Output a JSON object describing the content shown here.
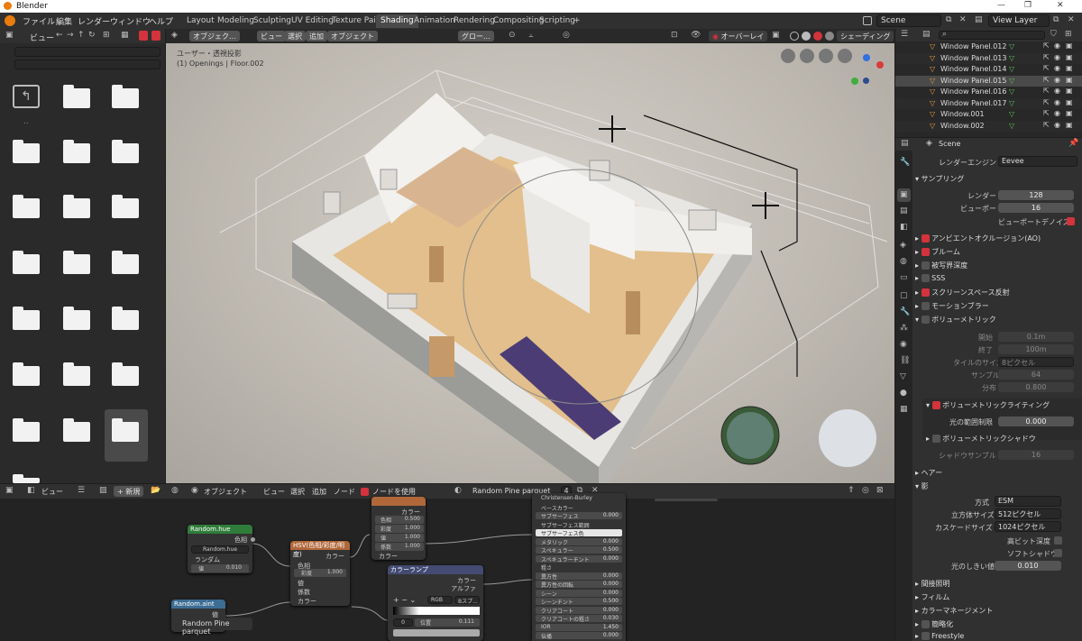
{
  "window": {
    "title": "Blender",
    "min": "—",
    "max": "❐",
    "close": "✕"
  },
  "menubar": {
    "items": [
      "ファイル",
      "編集",
      "レンダー",
      "ウィンドウ",
      "ヘルプ"
    ],
    "tabs": [
      "Layout",
      "Modeling",
      "Sculpting",
      "UV Editing",
      "Texture Paint",
      "Shading",
      "Animation",
      "Rendering",
      "Compositing",
      "Scripting"
    ],
    "active_tab": "Shading",
    "add_tab": "+",
    "scene": "Scene",
    "view_layer": "View Layer"
  },
  "filebrowser": {
    "view_label": "ビュー",
    "parent_label": ".."
  },
  "viewport": {
    "mode": "オブジェク...",
    "menu": [
      "ビュー",
      "選択",
      "追加",
      "オブジェクト"
    ],
    "transform": "グロー...",
    "overlay": "オーバーレイ",
    "shading": "シェーディング",
    "info_line1": "ユーザー・透視投影",
    "info_line2": "(1) Openings | Floor.002"
  },
  "outliner": {
    "rows": [
      {
        "name": "Window Panel.012",
        "selected": false
      },
      {
        "name": "Window Panel.013",
        "selected": false
      },
      {
        "name": "Window Panel.014",
        "selected": false
      },
      {
        "name": "Window Panel.015",
        "selected": true
      },
      {
        "name": "Window Panel.016",
        "selected": false
      },
      {
        "name": "Window Panel.017",
        "selected": false
      },
      {
        "name": "Window.001",
        "selected": false
      },
      {
        "name": "Window.002",
        "selected": false
      }
    ]
  },
  "properties": {
    "scene": "Scene",
    "engine_label": "レンダーエンジン",
    "engine_value": "Eevee",
    "sampling": "サンプリング",
    "render_label": "レンダー",
    "render_value": "128",
    "viewport_label": "ビューポート",
    "viewport_value": "16",
    "denoise_label": "ビューポートデノイズ",
    "ao": "アンビエントオクルージョン(AO)",
    "bloom": "ブルーム",
    "dof": "被写界深度",
    "sss": "SSS",
    "ssr": "スクリーンスペース反射",
    "motion_blur": "モーションブラー",
    "volumetrics": "ボリューメトリック",
    "start_label": "開始",
    "start_value": "0.1m",
    "end_label": "終了",
    "end_value": "100m",
    "tile_label": "タイルのサイズ",
    "tile_value": "8ピクセル",
    "samples_label": "サンプル",
    "samples_value": "64",
    "dist_label": "分布",
    "dist_value": "0.800",
    "vol_light": "ボリューメトリックライティング",
    "light_clamp_label": "光の範囲制限",
    "light_clamp_value": "0.000",
    "vol_shadow": "ボリューメトリックシャドウ",
    "shadow_samples_label": "シャドウサンプル",
    "shadow_samples_value": "16",
    "hair": "ヘアー",
    "shadows": "影",
    "method_label": "方式",
    "method_value": "ESM",
    "cube_label": "立方体サイズ",
    "cube_value": "512ピクセル",
    "cascade_label": "カスケードサイズ",
    "cascade_value": "1024ピクセル",
    "hibit_label": "高ビット深度",
    "soft_label": "ソフトシャドウ",
    "threshold_label": "光のしきい値",
    "threshold_value": "0.010",
    "indirect": "間接照明",
    "film": "フィルム",
    "color_mgmt": "カラーマネージメント",
    "simplify": "簡略化",
    "freestyle": "Freestyle"
  },
  "nodeeditor": {
    "view": "ビュー",
    "new": "新規",
    "object": "オブジェクト",
    "menu": [
      "ビュー",
      "選択",
      "追加",
      "ノード"
    ],
    "use_nodes": "ノードを使用",
    "material": "Random Pine parquet",
    "users": "4",
    "nodes": {
      "random_hue_title": "Random.hue",
      "random_hue_out": "色相",
      "random_hue_name": "Random.hue",
      "random_hue_input": "ランダム",
      "random_hue_field_label": "値",
      "random_hue_field_value": "0.010",
      "hsv_title": "HSV(色相/彩度/明度)",
      "hsv_out": "カラー",
      "hsv_r1": "色相",
      "hsv_r2_label": "彩度",
      "hsv_r2_value": "1.000",
      "hsv_r3": "値",
      "hsv_r4": "係数",
      "hsv_r5": "カラー",
      "hsv2_out": "カラー",
      "hsv2_r1_label": "色相",
      "hsv2_r1_value": "0.500",
      "hsv2_r2_label": "彩度",
      "hsv2_r2_value": "1.000",
      "hsv2_r3_label": "値",
      "hsv2_r3_value": "1.000",
      "hsv2_r4_label": "係数",
      "hsv2_r4_value": "1.000",
      "hsv2_r5": "カラー",
      "ramp_title": "カラーランプ",
      "ramp_out1": "カラー",
      "ramp_out2": "アルファ",
      "ramp_mode": "RGB",
      "ramp_interp": "Bスプ...",
      "ramp_index": "0",
      "ramp_pos_label": "位置",
      "ramp_pos_value": "0.111",
      "attr_title": "Random.aint",
      "attr_out": "値",
      "attr_name": "Random Pine parquet",
      "bsdf_rows": [
        {
          "label": "Christensen-Burley",
          "value": ""
        },
        {
          "label": "ベースカラー",
          "value": ""
        },
        {
          "label": "サブサーフェス",
          "value": "0.000"
        },
        {
          "label": "サブサーフェス範囲",
          "value": ""
        },
        {
          "label": "サブサーフェス色",
          "value": ""
        },
        {
          "label": "メタリック",
          "value": "0.000"
        },
        {
          "label": "スペキュラー",
          "value": "0.500"
        },
        {
          "label": "スペキュラーチント",
          "value": "0.000"
        },
        {
          "label": "粗さ",
          "value": ""
        },
        {
          "label": "異方性",
          "value": "0.000"
        },
        {
          "label": "異方性の回転",
          "value": "0.000"
        },
        {
          "label": "シーン",
          "value": "0.000"
        },
        {
          "label": "シーンチント",
          "value": "0.500"
        },
        {
          "label": "クリアコート",
          "value": "0.000"
        },
        {
          "label": "クリアコートの粗さ",
          "value": "0.030"
        },
        {
          "label": "IOR",
          "value": "1.450"
        },
        {
          "label": "伝播",
          "value": "0.000"
        }
      ]
    }
  }
}
